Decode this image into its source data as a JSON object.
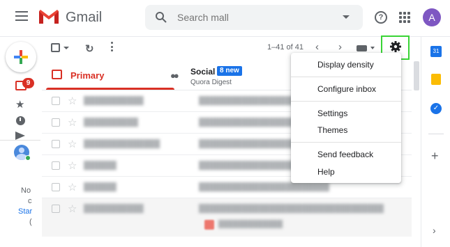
{
  "header": {
    "brand": "Gmail",
    "search_placeholder": "Search mall",
    "avatar_letter": "A"
  },
  "rail": {
    "inbox_badge": "9",
    "hint_lines": [
      "No",
      "c",
      "Star",
      "("
    ]
  },
  "toolbar": {
    "range": "1–41 of 41"
  },
  "tabs": {
    "primary": "Primary",
    "social": "Social",
    "social_badge": "8 new",
    "social_sub": "Quora Digest"
  },
  "settings_menu": {
    "items": [
      "Display density",
      "Configure inbox",
      "Settings",
      "Themes",
      "Send feedback",
      "Help"
    ]
  },
  "right_rail": {
    "calendar_label": "31"
  },
  "colors": {
    "accent_red": "#d93025",
    "highlight_green": "#39d435",
    "brand_blue": "#1a73e8"
  }
}
